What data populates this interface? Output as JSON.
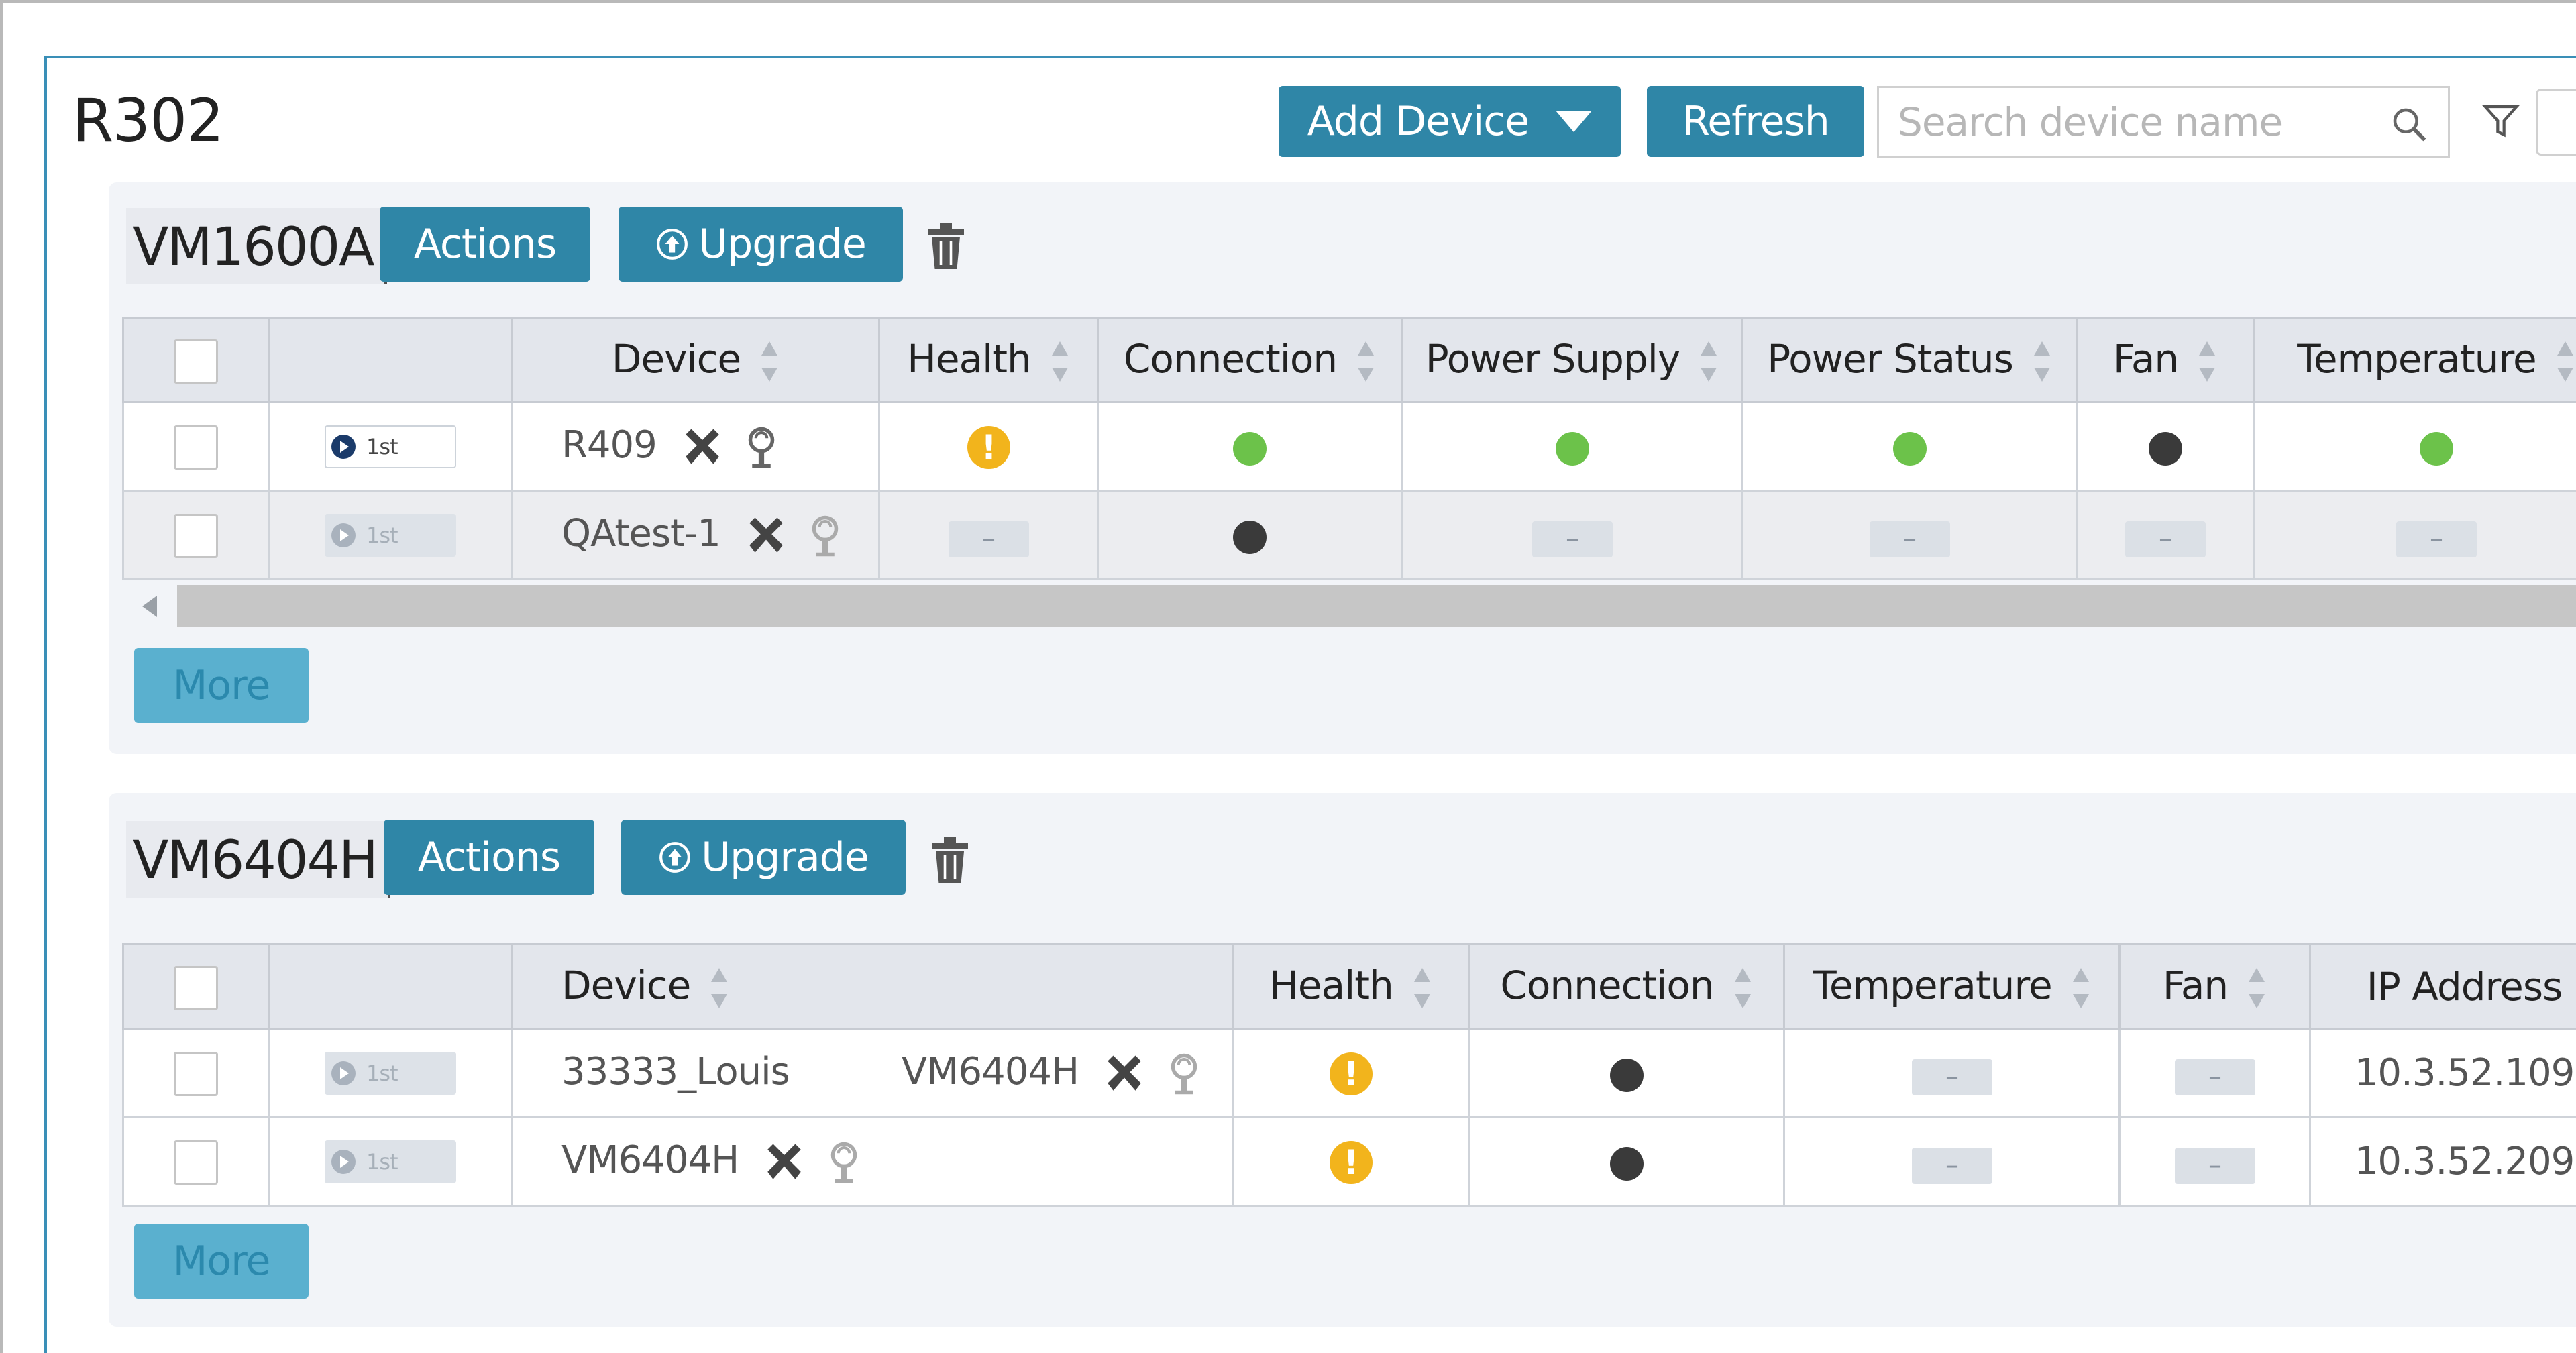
{
  "header": {
    "room_title": "R302",
    "add_device_label": "Add Device",
    "refresh_label": "Refresh",
    "search_placeholder": "Search device name"
  },
  "groups": [
    {
      "title": "VM1600A",
      "actions_label": "Actions",
      "upgrade_label": "Upgrade",
      "more_label": "More",
      "columns": [
        "Device",
        "Health",
        "Connection",
        "Power Supply",
        "Power Status",
        "Fan",
        "Temperature"
      ],
      "rows": [
        {
          "badge": "1st",
          "device": "R409",
          "health": "warning",
          "connection": "green",
          "power_supply": "green",
          "power_status": "green",
          "fan": "black",
          "temperature": "green"
        },
        {
          "badge": "1st",
          "device": "QAtest-1",
          "health": "none",
          "connection": "black",
          "power_supply": "none",
          "power_status": "none",
          "fan": "none",
          "temperature": "none"
        }
      ]
    },
    {
      "title": "VM6404H",
      "actions_label": "Actions",
      "upgrade_label": "Upgrade",
      "more_label": "More",
      "columns": [
        "Device",
        "Health",
        "Connection",
        "Temperature",
        "Fan",
        "IP Address"
      ],
      "rows": [
        {
          "badge": "1st",
          "device": "33333_Louis",
          "device_model": "VM6404H",
          "health": "warning",
          "connection": "black",
          "temperature": "none",
          "fan": "none",
          "ip": "10.3.52.109"
        },
        {
          "badge": "1st",
          "device": "VM6404H",
          "device_model": "",
          "health": "warning",
          "connection": "black",
          "temperature": "none",
          "fan": "none",
          "ip": "10.3.52.209"
        }
      ]
    }
  ],
  "status_symbols": {
    "warning": "!",
    "none": "–"
  },
  "colors": {
    "primary_button": "#2f86a7",
    "status_green": "#6cc24a",
    "status_black": "#3a3a3a",
    "status_warning": "#f2b41c",
    "panel_border": "#3a8fb7"
  }
}
